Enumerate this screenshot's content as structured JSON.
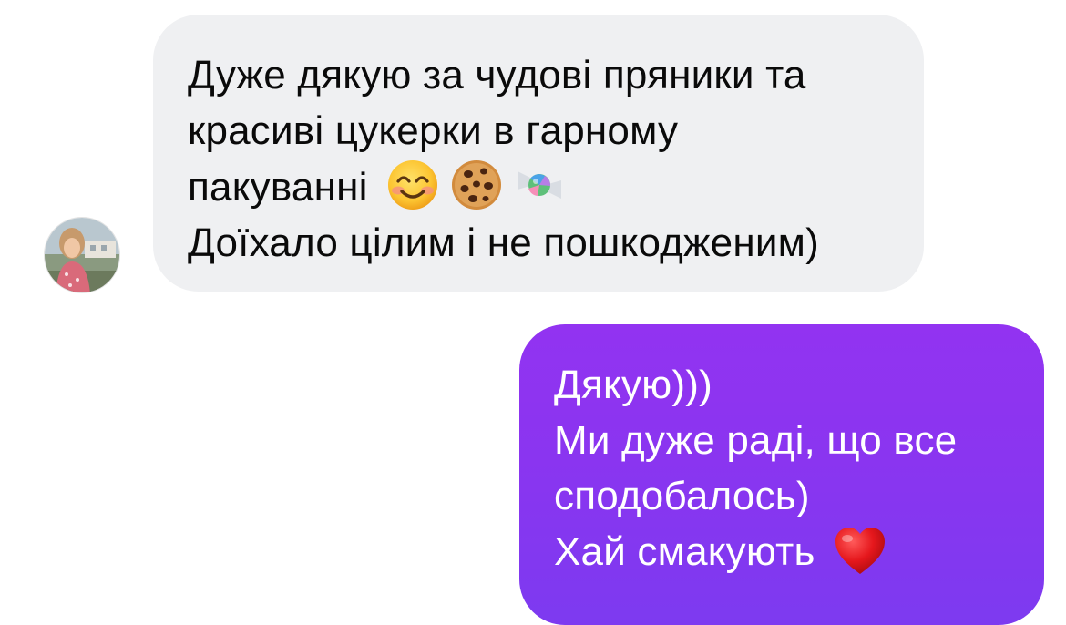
{
  "conversation": {
    "incoming": {
      "lines": [
        "Дуже дякую за чудові пряники та",
        "красиві цукерки в гарному",
        "пакуванні",
        "Доїхало цілим і не пошкодженим)"
      ],
      "emojis": [
        "smiling-face-emoji",
        "cookie-emoji",
        "candy-emoji"
      ]
    },
    "outgoing": {
      "lines": [
        "Дякую)))",
        "Ми дуже раді, що все",
        "сподобалось)",
        "Хай смакують"
      ],
      "emojis": [
        "red-heart-emoji"
      ]
    }
  },
  "colors": {
    "incoming_bubble": "#eff0f2",
    "outgoing_bubble_top": "#9233f1",
    "outgoing_bubble_bottom": "#7d3af0",
    "incoming_text": "#0a0a0a",
    "outgoing_text": "#ffffff"
  }
}
